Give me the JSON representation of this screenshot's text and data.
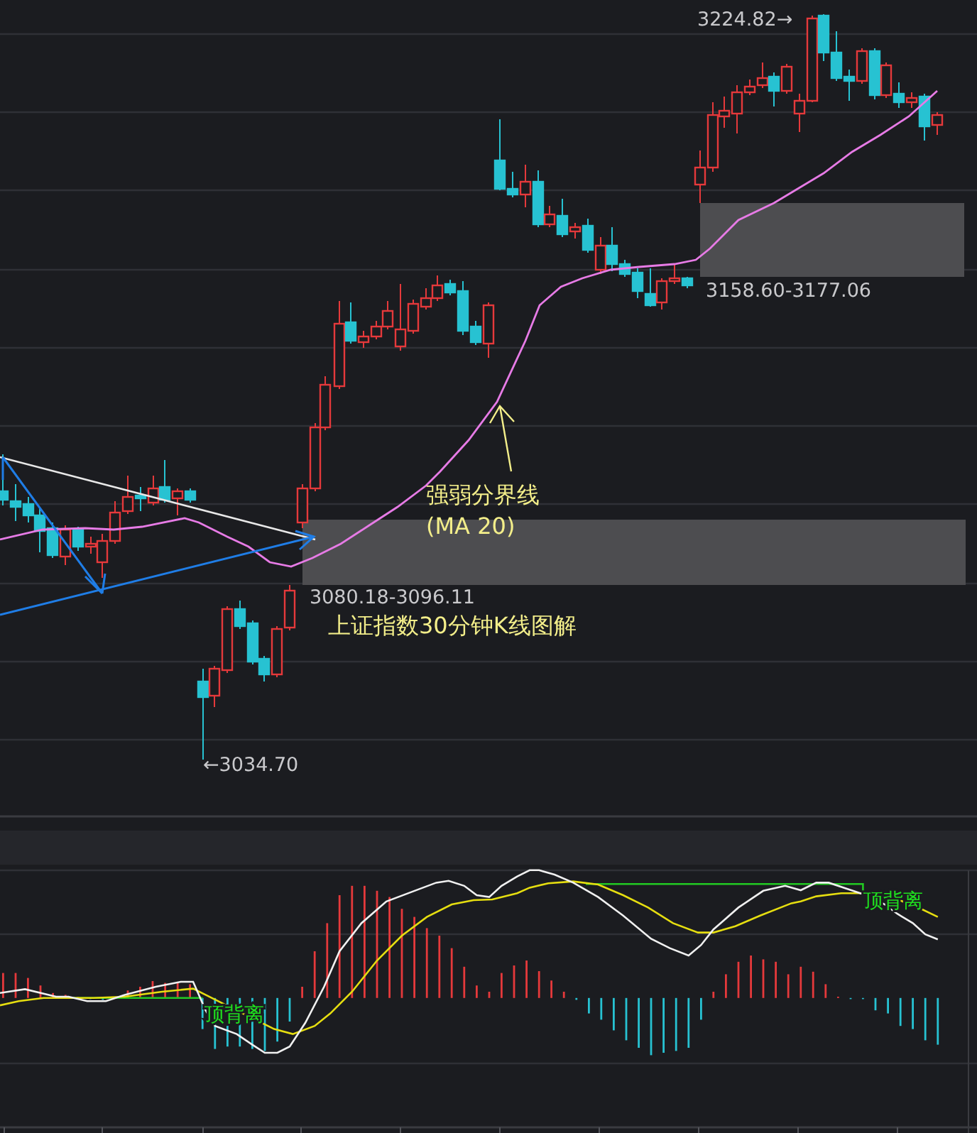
{
  "main_chart": {
    "high_label": "3224.82→",
    "low_label": "←3034.70",
    "upper_zone_label": "3158.60-3177.06",
    "lower_zone_label": "3080.18-3096.11",
    "ma_note_lines": [
      "强弱分界线",
      "(MA 20)"
    ],
    "caption": "上证指数30分钟K线图解"
  },
  "macd_panel": {
    "divergence_labels": [
      "顶背离",
      "顶背离"
    ]
  }
}
